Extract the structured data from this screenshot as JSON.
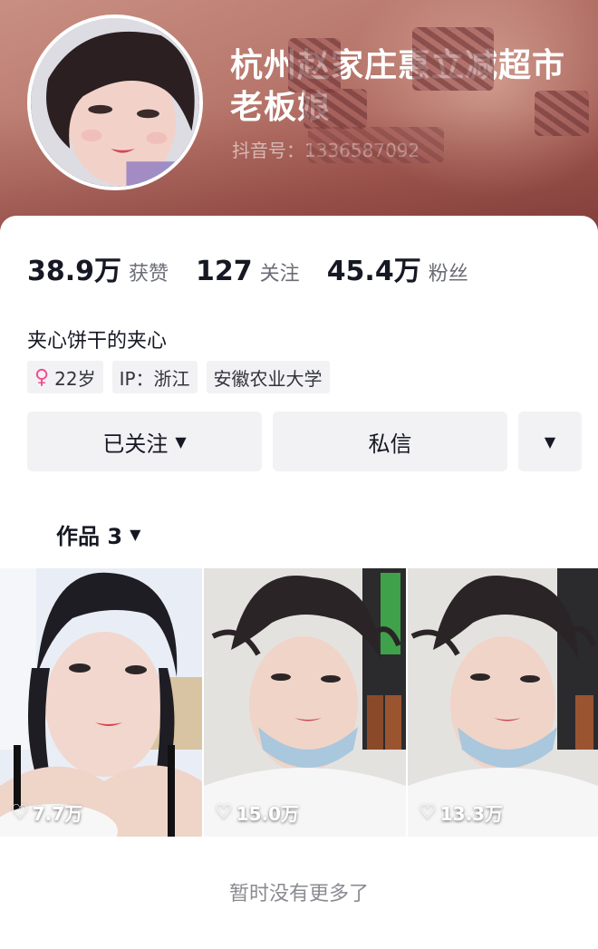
{
  "profile": {
    "nickname": "杭州赵家庄惠立减超市老板娘",
    "douyin_id": "抖音号：1336587092",
    "signature": "夹心饼干的夹心"
  },
  "stats": [
    {
      "value": "38.9万",
      "label": "获赞"
    },
    {
      "value": "127",
      "label": "关注"
    },
    {
      "value": "45.4万",
      "label": "粉丝"
    }
  ],
  "tags": {
    "age": "22岁",
    "gender_icon": "female-icon",
    "ip": "IP：浙江",
    "school": "安徽农业大学"
  },
  "actions": {
    "follow_label": "已关注",
    "message_label": "私信",
    "more_icon": "caret-down-icon"
  },
  "works": {
    "tab_label": "作品 3",
    "items": [
      {
        "likes": "7.7万"
      },
      {
        "likes": "15.0万"
      },
      {
        "likes": "13.3万"
      }
    ]
  },
  "footer": {
    "no_more": "暂时没有更多了"
  },
  "colors": {
    "banner": "#b8776c",
    "button_bg": "#f2f2f4",
    "gender": "#f04b8f"
  }
}
